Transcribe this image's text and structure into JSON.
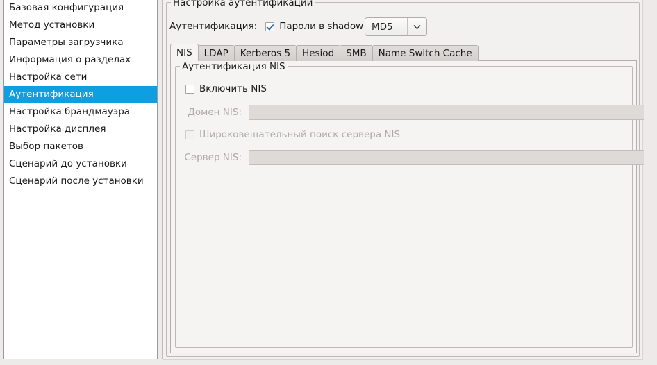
{
  "sidebar": {
    "items": [
      {
        "label": "Базовая конфигурация",
        "selected": false
      },
      {
        "label": "Метод установки",
        "selected": false
      },
      {
        "label": "Параметры загрузчика",
        "selected": false
      },
      {
        "label": "Информация о разделах",
        "selected": false
      },
      {
        "label": "Настройка сети",
        "selected": false
      },
      {
        "label": "Аутентификация",
        "selected": true
      },
      {
        "label": "Настройка брандмауэра",
        "selected": false
      },
      {
        "label": "Настройка дисплея",
        "selected": false
      },
      {
        "label": "Выбор пакетов",
        "selected": false
      },
      {
        "label": "Сценарий до установки",
        "selected": false
      },
      {
        "label": "Сценарий после установки",
        "selected": false
      }
    ],
    "selection_color": "#0d9fe2",
    "selection_text_color": "#ffffff"
  },
  "auth_group": {
    "title": "Настройка аутентификации",
    "row_label": "Аутентификация:",
    "shadow_checkbox": {
      "label": "Пароли в shadow",
      "checked": true
    },
    "algorithm_combo": {
      "value": "MD5",
      "arrow_icon": "chevron-down-icon"
    }
  },
  "tabs": [
    {
      "label": "NIS",
      "active": true
    },
    {
      "label": "LDAP",
      "active": false
    },
    {
      "label": "Kerberos 5",
      "active": false
    },
    {
      "label": "Hesiod",
      "active": false
    },
    {
      "label": "SMB",
      "active": false
    },
    {
      "label": "Name Switch Cache",
      "active": false
    }
  ],
  "nis_panel": {
    "title": "Аутентификация NIS",
    "enable_checkbox": {
      "label": "Включить NIS",
      "checked": false,
      "disabled": false
    },
    "domain_field": {
      "label": "Домен NIS:",
      "value": "",
      "disabled": true
    },
    "broadcast_checkbox": {
      "label": "Широковещательный поиск сервера NIS",
      "checked": false,
      "disabled": true
    },
    "server_field": {
      "label": "Сервер NIS:",
      "value": "",
      "disabled": true
    }
  }
}
